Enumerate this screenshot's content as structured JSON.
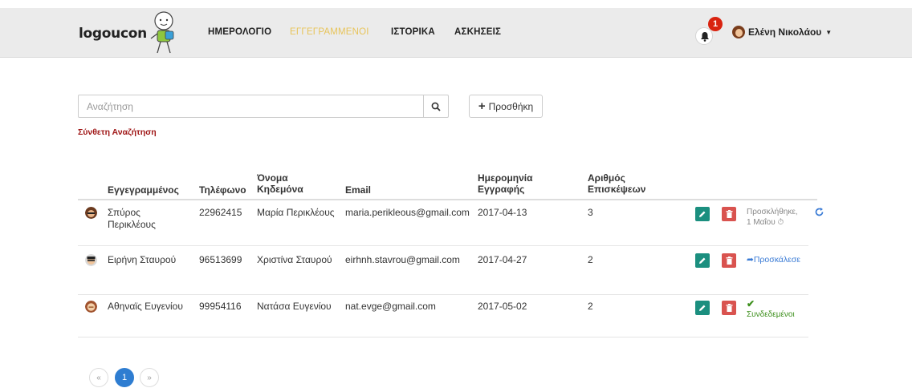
{
  "navbar": {
    "logo": "logoucon",
    "links": [
      "ΗΜΕΡΟΛΟΓΙΟ",
      "ΕΓΓΕΓΡΑΜΜΕΝΟΙ",
      "ΙΣΤΟΡΙΚΑ",
      "ΑΣΚΗΣΕΙΣ"
    ],
    "active_link": "ΕΓΓΕΓΡΑΜΜΕΝΟΙ",
    "notification_count": "1",
    "user_name": "Ελένη Νικολάου"
  },
  "search": {
    "placeholder": "Αναζήτηση",
    "add_label": "Προσθήκη",
    "advanced_label": "Σύνθετη Αναζήτηση"
  },
  "table": {
    "headers": {
      "enrolled": "Εγγεγραμμένος",
      "phone": "Τηλέφωνο",
      "guardian_line1": "Όνομα",
      "guardian_line2": "Κηδεμόνα",
      "email": "Email",
      "date_line1": "Ημερομηνία",
      "date_line2": "Εγγραφής",
      "visits_line1": "Αριθμός",
      "visits_line2": "Επισκέψεων"
    },
    "rows": [
      {
        "name_line1": "Σπύρος",
        "name_line2": "Περικλέους",
        "phone": "22962415",
        "guardian": "Μαρία Περικλέους",
        "email": "maria.perikleous@gmail.com",
        "date": "2017-04-13",
        "visits": "3",
        "status_line1": "Προσκλήθηκε,",
        "status_line2": "1 Μαΐου"
      },
      {
        "name": "Ειρήνη Σταυρού",
        "phone": "96513699",
        "guardian": "Χριστίνα Σταυρού",
        "email": "eirhnh.stavrou@gmail.com",
        "date": "2017-04-27",
        "visits": "2",
        "status": "Προσκάλεσε"
      },
      {
        "name": "Αθηναϊς Ευγενίου",
        "phone": "99954116",
        "guardian": "Νατάσα Ευγενίου",
        "email": "nat.evge@gmail.com",
        "date": "2017-05-02",
        "visits": "2",
        "status": "Συνδεδεμένοι"
      }
    ]
  },
  "pagination": {
    "prev": "«",
    "current": "1",
    "next": "»"
  },
  "colors": {
    "active_nav": "#e8c45a",
    "edit_button": "#1b8f7f",
    "delete_button": "#d9534f",
    "advanced_search": "#a01818",
    "link": "#3a7bd5",
    "connected": "#3c8f1b",
    "badge": "#d9230f"
  }
}
